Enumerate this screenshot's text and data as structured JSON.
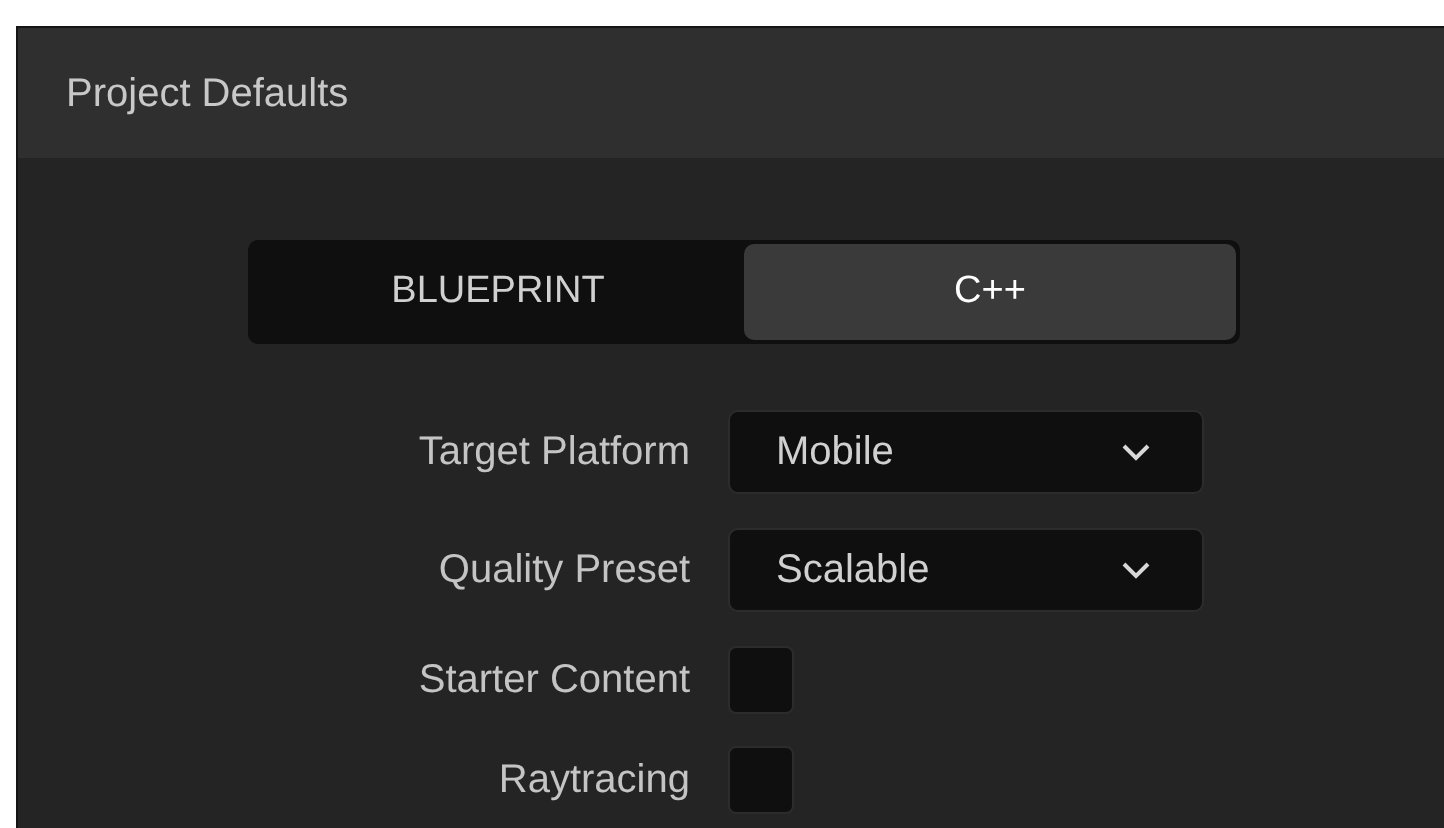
{
  "panel": {
    "title": "Project Defaults"
  },
  "modes": [
    {
      "label": "BLUEPRINT",
      "selected": false
    },
    {
      "label": "C++",
      "selected": true
    }
  ],
  "settings": [
    {
      "kind": "dropdown",
      "label": "Target Platform",
      "value": "Mobile"
    },
    {
      "kind": "dropdown",
      "label": "Quality Preset",
      "value": "Scalable"
    },
    {
      "kind": "checkbox",
      "label": "Starter Content",
      "checked": false
    },
    {
      "kind": "checkbox",
      "label": "Raytracing",
      "checked": false
    }
  ]
}
